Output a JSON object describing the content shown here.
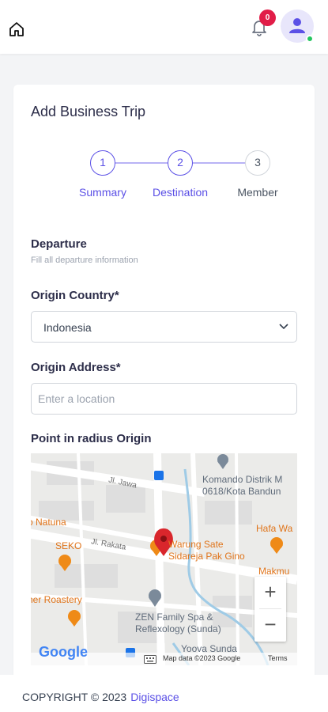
{
  "header": {
    "notification_count": "0",
    "icons": [
      "home-icon",
      "bell-icon",
      "user-icon"
    ]
  },
  "form": {
    "title": "Add Business Trip",
    "steps": [
      {
        "number": "1",
        "label": "Summary",
        "state": "complete"
      },
      {
        "number": "2",
        "label": "Destination",
        "state": "active"
      },
      {
        "number": "3",
        "label": "Member",
        "state": "upcoming"
      }
    ],
    "section": {
      "title": "Departure",
      "subtitle": "Fill all departure information"
    },
    "origin_country": {
      "label": "Origin Country*",
      "value": "Indonesia"
    },
    "origin_address": {
      "label": "Origin Address*",
      "value": "",
      "placeholder": "Enter a location"
    },
    "map": {
      "label": "Point in radius Origin",
      "places": {
        "komando_line1": "Komando Distrik M",
        "komando_line2": "0618/Kota Bandun",
        "jl_jawa": "Jl. Jawa",
        "natuna": "o Natuna",
        "hafa": "Hafa Wa",
        "seko": "SEKO",
        "jl_rakata": "Jl. Rakata",
        "warung_line1": "Warung Sate",
        "warung_line2": "Sidareja Pak Gino",
        "makmur": "Makmu",
        "roastery": "ner Roastery",
        "zen_line1": "ZEN Family Spa &",
        "zen_line2": "Reflexology (Sunda)",
        "yoova": "Yoova Sunda"
      },
      "zoom_in": "+",
      "zoom_out": "−",
      "brand": "Google",
      "attribution": "Map data ©2023 Google",
      "terms": "Terms"
    }
  },
  "footer": {
    "copyright": "COPYRIGHT © 2023",
    "brand": "Digispace"
  },
  "colors": {
    "primary": "#5b50e6",
    "badge": "#e11d48",
    "online": "#22c55e",
    "map_orange": "#ef8a17",
    "map_red_pin": "#d9262c"
  }
}
